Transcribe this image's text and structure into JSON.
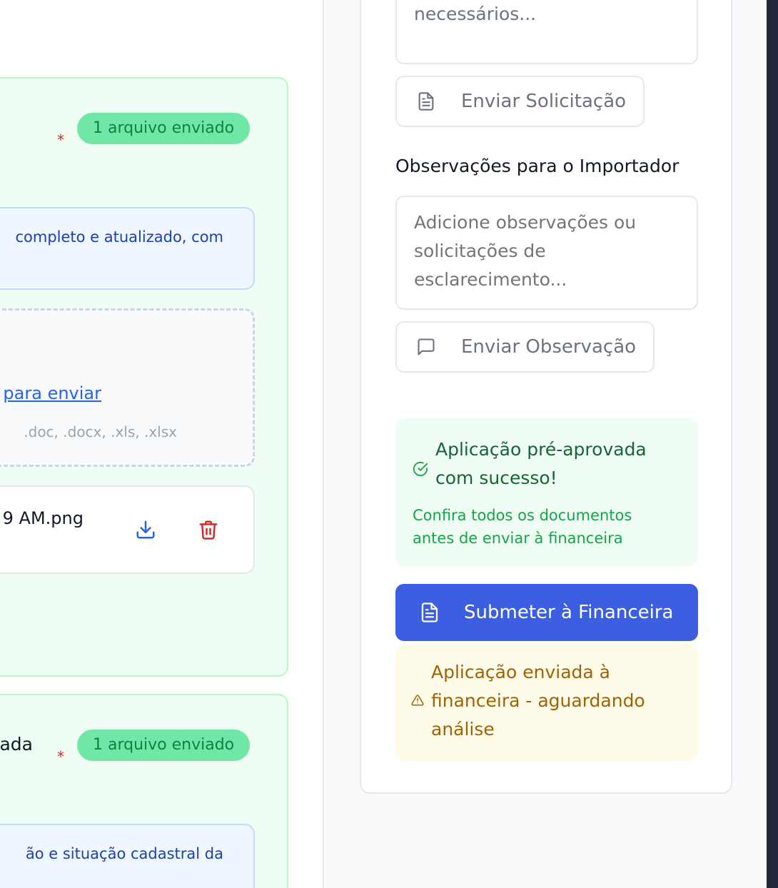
{
  "documents": [
    {
      "title": "",
      "required_mark": "*",
      "status_badge": "1 arquivo enviado",
      "info_text": "completo e atualizado, com",
      "upload_link": "para enviar",
      "accepted_types": ".doc, .docx, .xls, .xlsx",
      "file_name": "9 AM.png"
    },
    {
      "title": "ada",
      "required_mark": "*",
      "status_badge": "1 arquivo enviado",
      "info_text": "ão e situação cadastral da"
    }
  ],
  "sidebar": {
    "request_textarea_value": "documentos adicionais são necessários...",
    "send_request_button": "Enviar Solicitação",
    "observations_heading": "Observações para o Importador",
    "observations_placeholder": "Adicione observações ou solicitações de esclarecimento...",
    "send_observation_button": "Enviar Observação",
    "success_title": "Aplicação pré-aprovada com sucesso!",
    "success_subtitle": "Confira todos os documentos antes de enviar à financeira",
    "submit_button": "Submeter à Financeira",
    "warning_text": "Aplicação enviada à financeira - aguardando análise"
  },
  "icons": {
    "download": "download-icon",
    "delete": "trash-icon",
    "send_request": "file-text-icon",
    "send_observation": "message-square-icon",
    "success": "check-circle-icon",
    "submit": "file-text-icon",
    "warning": "alert-triangle-icon"
  },
  "colors": {
    "primary": "#3b5fe0",
    "success_bg": "#f0fdf4",
    "success_text": "#166534",
    "badge_bg": "#6ee7a7",
    "warning_bg": "#fefce8",
    "warning_text": "#a16207",
    "danger": "#dc2626",
    "link": "#2563eb"
  }
}
